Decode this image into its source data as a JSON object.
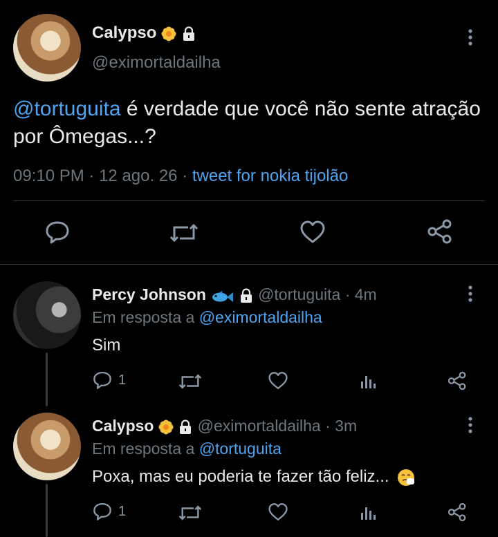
{
  "main_tweet": {
    "display_name": "Calypso",
    "handle": "@eximortaldailha",
    "mention": "@tortuguita",
    "text": " é verdade que você não sente atração por Ômegas...?",
    "time": "09:10 PM",
    "date": "12 ago. 26",
    "source": "tweet for nokia tijolão"
  },
  "replies": [
    {
      "display_name": "Percy Johnson",
      "handle": "@tortuguita",
      "age": "4m",
      "reply_prefix": "Em resposta a",
      "reply_to": "@eximortaldailha",
      "text": "Sim",
      "reply_count": "1"
    },
    {
      "display_name": "Calypso",
      "handle": "@eximortaldailha",
      "age": "3m",
      "reply_prefix": "Em resposta a",
      "reply_to": "@tortuguita",
      "text": "Poxa, mas eu poderia te fazer tão feliz...",
      "reply_count": "1"
    }
  ],
  "colors": {
    "background": "#000000",
    "text": "#e7e9ea",
    "muted": "#6e767d",
    "link": "#4ea4f0",
    "divider": "#2f3336"
  },
  "icons": [
    "more-vert-icon",
    "reply-icon",
    "retweet-icon",
    "like-icon",
    "share-icon",
    "analytics-icon",
    "flower-emoji-icon",
    "lock-icon",
    "fish-emoji-icon",
    "sneeze-emoji-icon"
  ]
}
